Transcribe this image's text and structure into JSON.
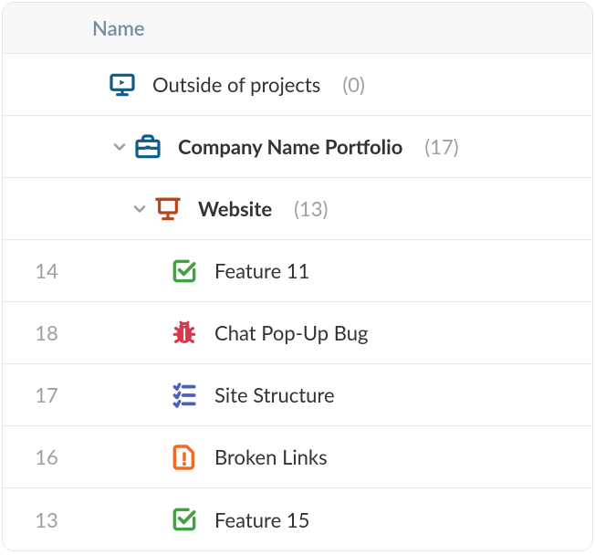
{
  "header": {
    "name_col": "Name"
  },
  "rows": [
    {
      "label": "Outside of projects",
      "count": "(0)"
    },
    {
      "label": "Company Name  Portfolio",
      "count": "(17)"
    },
    {
      "label": "Website",
      "count": "(13)"
    }
  ],
  "items": [
    {
      "num": "14",
      "label": "Feature 11"
    },
    {
      "num": "18",
      "label": "Chat Pop-Up Bug"
    },
    {
      "num": "17",
      "label": "Site Structure"
    },
    {
      "num": "16",
      "label": "Broken Links"
    },
    {
      "num": "13",
      "label": "Feature 15"
    }
  ]
}
